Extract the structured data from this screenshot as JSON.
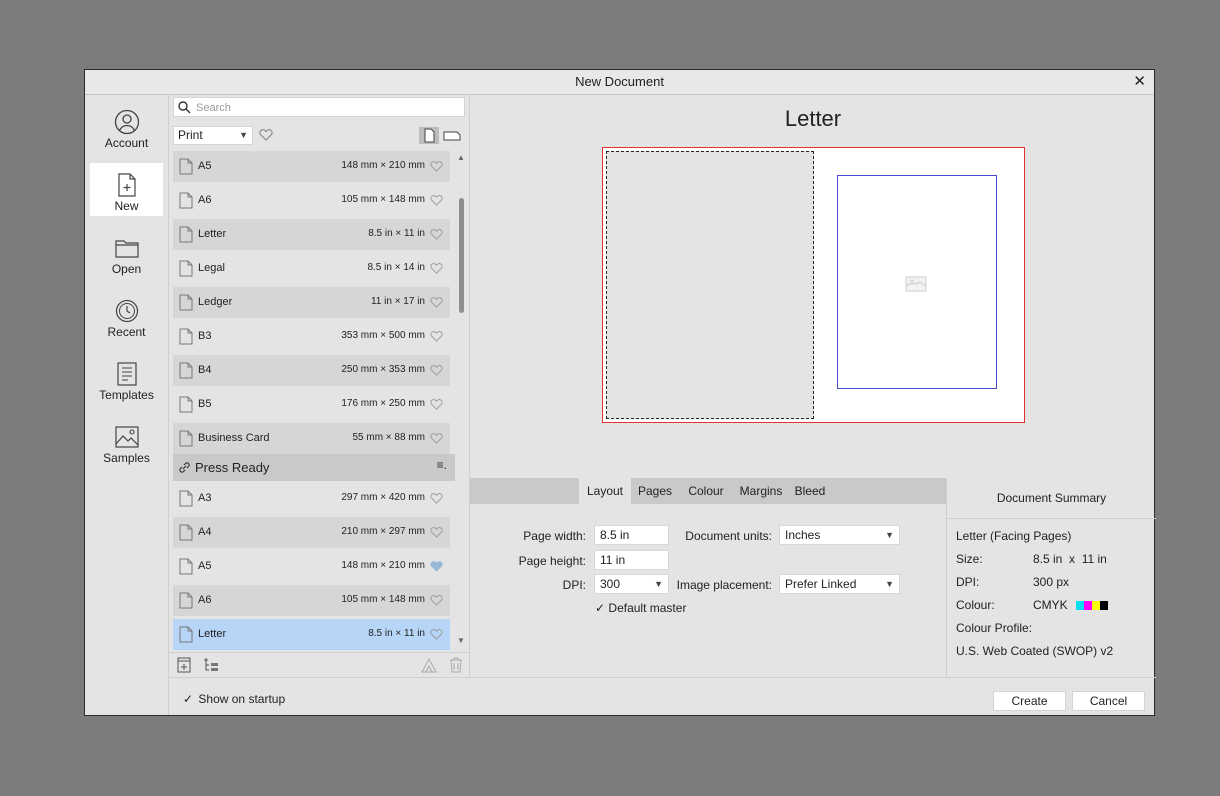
{
  "dialog": {
    "title": "New Document"
  },
  "nav": {
    "items": [
      {
        "label": "Account",
        "icon": "account-icon"
      },
      {
        "label": "New",
        "icon": "new-document-icon"
      },
      {
        "label": "Open",
        "icon": "folder-icon"
      },
      {
        "label": "Recent",
        "icon": "recent-clock-icon"
      },
      {
        "label": "Templates",
        "icon": "templates-icon"
      },
      {
        "label": "Samples",
        "icon": "samples-image-icon"
      }
    ],
    "active": "New"
  },
  "list": {
    "search_placeholder": "Search",
    "category": "Print",
    "print_items": [
      {
        "name": "A5",
        "size": "148 mm × 210 mm",
        "favourite": false
      },
      {
        "name": "A6",
        "size": "105 mm × 148 mm",
        "favourite": false
      },
      {
        "name": "Letter",
        "size": "8.5 in × 11 in",
        "favourite": false
      },
      {
        "name": "Legal",
        "size": "8.5 in × 14 in",
        "favourite": false
      },
      {
        "name": "Ledger",
        "size": "11 in × 17 in",
        "favourite": false
      },
      {
        "name": "B3",
        "size": "353 mm × 500 mm",
        "favourite": false
      },
      {
        "name": "B4",
        "size": "250 mm × 353 mm",
        "favourite": false
      },
      {
        "name": "B5",
        "size": "176 mm × 250 mm",
        "favourite": false
      },
      {
        "name": "Business Card",
        "size": "55 mm × 88 mm",
        "favourite": false
      }
    ],
    "section_title": "Press Ready",
    "press_items": [
      {
        "name": "A3",
        "size": "297 mm × 420 mm",
        "favourite": false
      },
      {
        "name": "A4",
        "size": "210 mm × 297 mm",
        "favourite": false
      },
      {
        "name": "A5",
        "size": "148 mm × 210 mm",
        "favourite": true
      },
      {
        "name": "A6",
        "size": "105 mm × 148 mm",
        "favourite": false
      },
      {
        "name": "Letter",
        "size": "8.5 in × 11 in",
        "favourite": false,
        "selected": true
      }
    ]
  },
  "preview": {
    "title": "Letter"
  },
  "tabs": [
    "Layout",
    "Pages",
    "Colour",
    "Margins",
    "Bleed"
  ],
  "active_tab": "Layout",
  "layout": {
    "page_width_label": "Page width:",
    "page_width": "8.5 in",
    "page_height_label": "Page height:",
    "page_height": "11 in",
    "dpi_label": "DPI:",
    "dpi": "300",
    "document_units_label": "Document units:",
    "document_units": "Inches",
    "image_placement_label": "Image placement:",
    "image_placement": "Prefer Linked",
    "default_master_label": "Default master",
    "default_master_checked": true
  },
  "summary": {
    "header": "Document Summary",
    "doc_type": "Letter (Facing Pages)",
    "size_label": "Size:",
    "size_value": "8.5 in  x  11 in",
    "dpi_label": "DPI:",
    "dpi_value": "300 px",
    "colour_label": "Colour:",
    "colour_value": "CMYK",
    "cmyk_swatches": [
      "#00e0f0",
      "#ff00ff",
      "#ffff00",
      "#000000"
    ],
    "profile_label": "Colour Profile:",
    "profile_value": "U.S. Web Coated (SWOP) v2"
  },
  "footer": {
    "show_on_startup_label": "Show on startup",
    "show_on_startup_checked": true,
    "create_label": "Create",
    "cancel_label": "Cancel"
  },
  "colors": {
    "selection": "#b7d5f7",
    "bleed_outline": "#e03030",
    "margin_outline": "#4a4ad0",
    "favourite_active": "#9ab8d8"
  }
}
